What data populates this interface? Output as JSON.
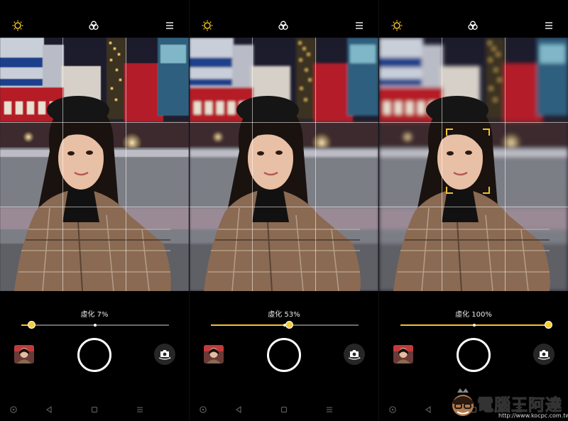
{
  "screens": [
    {
      "blur_label": "虛化 7%",
      "blur_value": 0.07,
      "show_face_box": false
    },
    {
      "blur_label": "虛化 53%",
      "blur_value": 0.53,
      "show_face_box": false
    },
    {
      "blur_label": "虛化 100%",
      "blur_value": 1.0,
      "show_face_box": true
    }
  ],
  "slider_marker": 0.5,
  "icons": {
    "top_left": "sun-icon",
    "top_center": "filter-icon",
    "top_right": "menu-icon",
    "switch": "switch-camera-icon",
    "nav": [
      "circle-nav-icon",
      "back-icon",
      "home-icon",
      "recents-icon"
    ]
  },
  "colors": {
    "accent": "#f2c230",
    "track": "#6a6a6a",
    "background": "#000000"
  },
  "watermark": {
    "brand": "電腦王阿達",
    "url": "http://www.kocpc.com.tw"
  }
}
